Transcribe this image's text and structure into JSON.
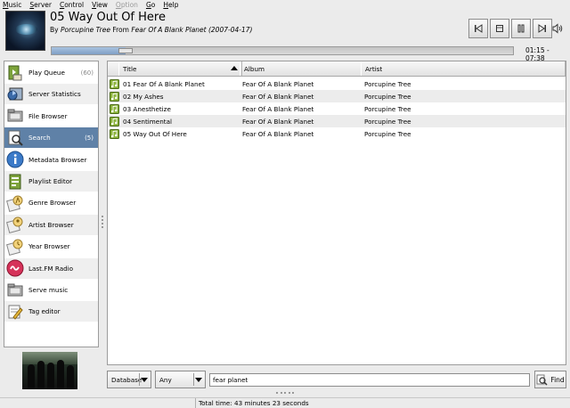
{
  "menu": [
    {
      "label": "Music",
      "u": "M",
      "rest": "usic",
      "disabled": false
    },
    {
      "label": "Server",
      "u": "S",
      "rest": "erver",
      "disabled": false
    },
    {
      "label": "Control",
      "u": "C",
      "rest": "ontrol",
      "disabled": false
    },
    {
      "label": "View",
      "u": "V",
      "rest": "iew",
      "disabled": false
    },
    {
      "label": "Option",
      "u": "O",
      "rest": "ption",
      "disabled": true
    },
    {
      "label": "Go",
      "u": "G",
      "rest": "o",
      "disabled": false
    },
    {
      "label": "Help",
      "u": "H",
      "rest": "elp",
      "disabled": false
    }
  ],
  "now_playing": {
    "title": "05 Way Out Of Here",
    "by_label": "By",
    "artist": "Porcupine Tree",
    "from_label": "From",
    "album": "Fear Of A Blank Planet (2007-04-17)",
    "time": "01:15 - 07:38",
    "progress": 0.16
  },
  "controls": [
    "previous-icon",
    "stop-icon",
    "pause-icon",
    "next-icon",
    "volume-icon"
  ],
  "sidebar": [
    {
      "label": "Play Queue",
      "count": "(60)",
      "icon": "play-queue-icon"
    },
    {
      "label": "Server Statistics",
      "count": "",
      "icon": "server-statistics-icon"
    },
    {
      "label": "File Browser",
      "count": "",
      "icon": "file-browser-icon"
    },
    {
      "label": "Search",
      "count": "(5)",
      "icon": "search-icon",
      "selected": true
    },
    {
      "label": "Metadata Browser",
      "count": "",
      "icon": "info-icon"
    },
    {
      "label": "Playlist Editor",
      "count": "",
      "icon": "playlist-editor-icon"
    },
    {
      "label": "Genre Browser",
      "count": "",
      "icon": "genre-browser-icon"
    },
    {
      "label": "Artist Browser",
      "count": "",
      "icon": "artist-browser-icon"
    },
    {
      "label": "Year Browser",
      "count": "",
      "icon": "year-browser-icon"
    },
    {
      "label": "Last.FM Radio",
      "count": "",
      "icon": "lastfm-icon"
    },
    {
      "label": "Serve music",
      "count": "",
      "icon": "serve-music-icon"
    },
    {
      "label": "Tag editor",
      "count": "",
      "icon": "tag-editor-icon"
    }
  ],
  "table": {
    "columns": [
      "Title",
      "Album",
      "Artist"
    ],
    "sorted_column": "Title",
    "rows": [
      {
        "title": "01 Fear Of A Blank Planet",
        "album": "Fear Of A Blank Planet",
        "artist": "Porcupine Tree"
      },
      {
        "title": "02 My Ashes",
        "album": "Fear Of A Blank Planet",
        "artist": "Porcupine Tree"
      },
      {
        "title": "03 Anesthetize",
        "album": "Fear Of A Blank Planet",
        "artist": "Porcupine Tree"
      },
      {
        "title": "04 Sentimental",
        "album": "Fear Of A Blank Planet",
        "artist": "Porcupine Tree"
      },
      {
        "title": "05 Way Out Of Here",
        "album": "Fear Of A Blank Planet",
        "artist": "Porcupine Tree"
      }
    ]
  },
  "search": {
    "scope": "Database",
    "field": "Any",
    "query": "fear planet",
    "find_label": "Find"
  },
  "status": {
    "total_time": "Total time: 43 minutes 23 seconds"
  },
  "colors": {
    "selection": "#5f81a7",
    "progress_fill": "#8fb0d6"
  }
}
